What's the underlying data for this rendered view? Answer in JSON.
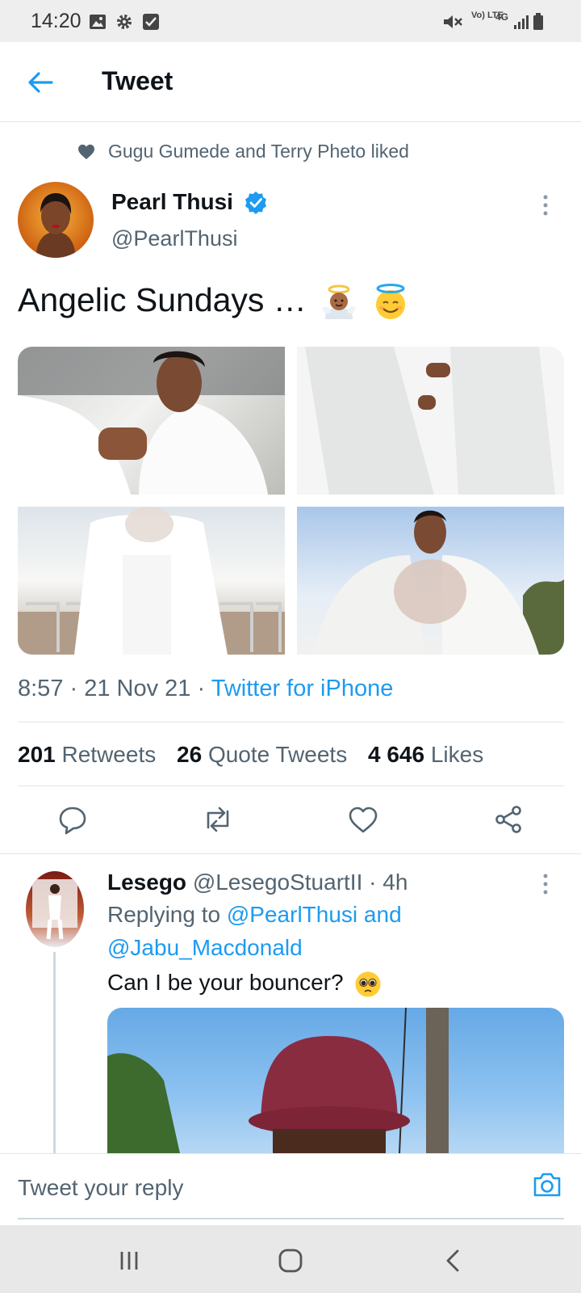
{
  "status_bar": {
    "time": "14:20",
    "left_icons": [
      "image-icon",
      "gear-icon",
      "checkbox-icon"
    ],
    "right_icons": [
      "mute-icon",
      "volte-icon",
      "network-4g-icon",
      "signal-icon",
      "battery-icon"
    ],
    "volte_label": "Vo) LTE",
    "network_label": "4G"
  },
  "header": {
    "title": "Tweet"
  },
  "tweet": {
    "social_context": "Gugu Gumede and Terry Pheto liked",
    "author_name": "Pearl Thusi",
    "handle": "@PearlThusi",
    "verified": true,
    "text": "Angelic Sundays …",
    "emojis": [
      "baby-angel-emoji",
      "smiling-face-with-halo-emoji"
    ],
    "media_count": 4,
    "time": "8:57",
    "date": "21 Nov 21",
    "source": "Twitter for iPhone",
    "stats": {
      "retweets_count": "201",
      "retweets_label": "Retweets",
      "quotes_count": "26",
      "quotes_label": "Quote Tweets",
      "likes_count": "4 646",
      "likes_label": "Likes"
    },
    "actions": [
      "reply-icon",
      "retweet-icon",
      "like-icon",
      "share-icon"
    ]
  },
  "reply": {
    "author_name": "Lesego",
    "handle": "@LesegoStuartII",
    "age": "4h",
    "replying_prefix": "Replying to",
    "mention_1": "@PearlThusi",
    "and_word": "and",
    "mention_2": "@Jabu_Macdonald",
    "text": "Can I be your bouncer?",
    "emoji": "pleading-face-emoji"
  },
  "composer": {
    "placeholder": "Tweet your reply"
  },
  "colors": {
    "accent": "#1d9bf0",
    "text_primary": "#0f1419",
    "text_secondary": "#536471",
    "divider": "#e1e6ea"
  }
}
